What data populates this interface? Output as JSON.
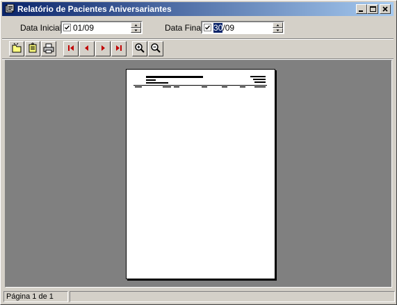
{
  "window": {
    "title": "Relatório de Pacientes Aniversariantes"
  },
  "filters": {
    "start_label": "Data Inicial:",
    "start_value": "01/09",
    "end_label": "Data Final:",
    "end_value_selected": "30",
    "end_value_rest": "/09"
  },
  "toolbar": {
    "icons": [
      "open-report-icon",
      "save-report-icon",
      "print-icon",
      "first-page-icon",
      "previous-page-icon",
      "next-page-icon",
      "last-page-icon",
      "zoom-in-icon",
      "zoom-out-icon"
    ]
  },
  "status": {
    "page_info": "Página 1 de 1"
  }
}
